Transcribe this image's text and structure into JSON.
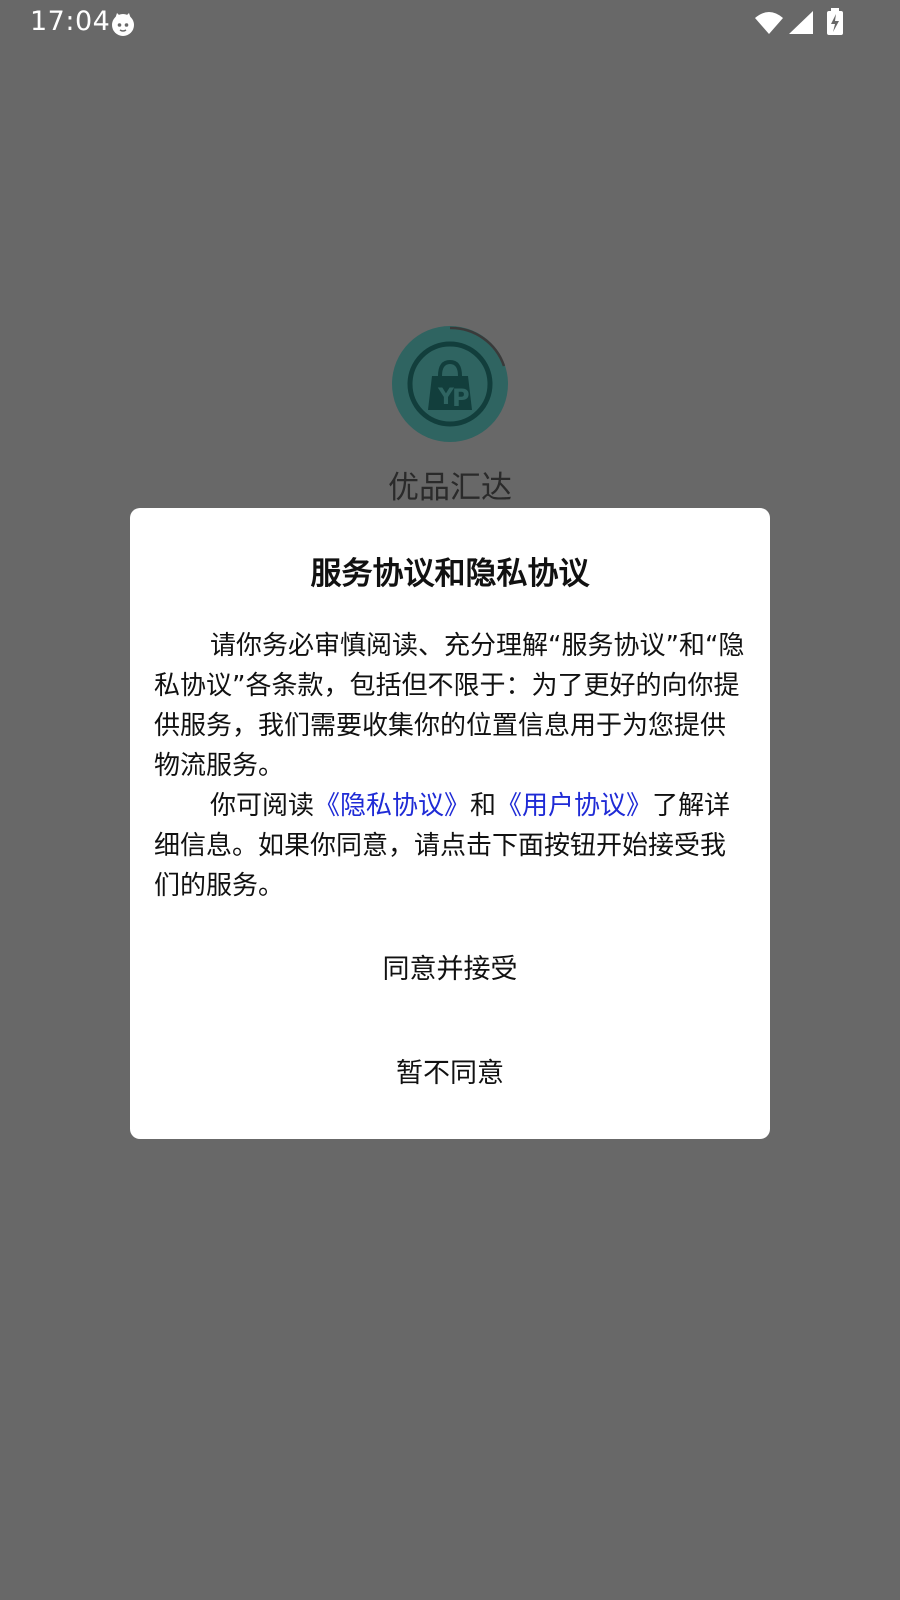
{
  "status_bar": {
    "time": "17:04",
    "icons": [
      "cat-icon",
      "wifi-icon",
      "signal-icon",
      "battery-charging-icon"
    ]
  },
  "splash": {
    "logo_icon": "shopping-bag-yp-logo",
    "app_name": "优品汇达",
    "logo_color": "#2f6461"
  },
  "dialog": {
    "title": "服务协议和隐私协议",
    "paragraph1": "请你务必审慎阅读、充分理解“服务协议”和“隐私协议”各条款，包括但不限于：为了更好的向你提供服务，我们需要收集你的位置信息用于为您提供物流服务。",
    "paragraph2_prefix": "你可阅读",
    "privacy_link": "《隐私协议》",
    "and_text": "和",
    "user_link": "《用户协议》",
    "paragraph2_suffix": "了解详细信息。如果你同意，请点击下面按钮开始接受我们的服务。",
    "agree_button": "同意并接受",
    "decline_button": "暂不同意",
    "link_color": "#1f2bd6"
  }
}
